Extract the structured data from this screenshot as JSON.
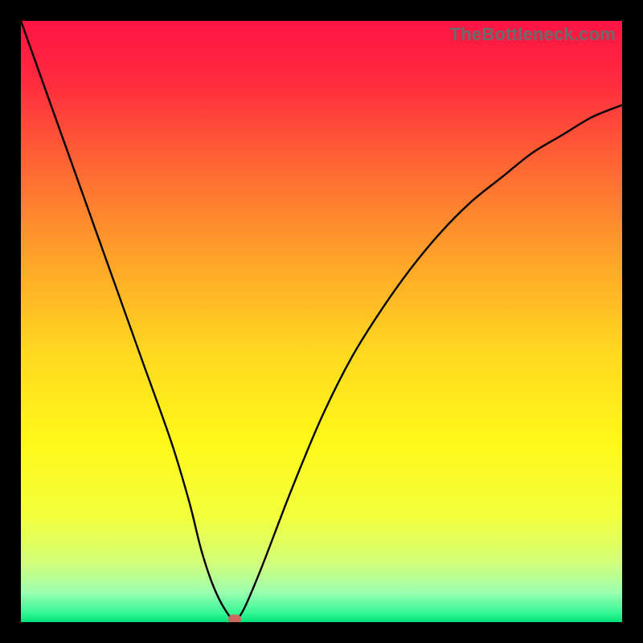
{
  "watermark": "TheBottleneck.com",
  "chart_data": {
    "type": "line",
    "title": "",
    "xlabel": "",
    "ylabel": "",
    "xlim": [
      0,
      100
    ],
    "ylim": [
      0,
      100
    ],
    "grid": false,
    "legend": false,
    "background_gradient": {
      "stops": [
        {
          "pos": 0.0,
          "color": "#ff1444"
        },
        {
          "pos": 0.1,
          "color": "#ff2b3f"
        },
        {
          "pos": 0.25,
          "color": "#ff6a33"
        },
        {
          "pos": 0.4,
          "color": "#ffa529"
        },
        {
          "pos": 0.55,
          "color": "#ffd820"
        },
        {
          "pos": 0.7,
          "color": "#fff81a"
        },
        {
          "pos": 0.82,
          "color": "#f3ff3a"
        },
        {
          "pos": 0.9,
          "color": "#d4ff77"
        },
        {
          "pos": 0.95,
          "color": "#9dffb0"
        },
        {
          "pos": 0.985,
          "color": "#35f796"
        },
        {
          "pos": 1.0,
          "color": "#00e17a"
        }
      ]
    },
    "series": [
      {
        "name": "bottleneck-curve",
        "color": "#000000",
        "x": [
          0,
          5,
          10,
          15,
          20,
          25,
          28,
          30,
          32,
          34,
          35.5,
          37,
          40,
          45,
          50,
          55,
          60,
          65,
          70,
          75,
          80,
          85,
          90,
          95,
          100
        ],
        "y": [
          100,
          86,
          72,
          58,
          44,
          30,
          20,
          12,
          6,
          2,
          0.5,
          2,
          9,
          22,
          34,
          44,
          52,
          59,
          65,
          70,
          74,
          78,
          81,
          84,
          86
        ]
      }
    ],
    "marker": {
      "name": "min-point",
      "x": 35.5,
      "y": 0.5,
      "color": "#c86a5e"
    }
  }
}
